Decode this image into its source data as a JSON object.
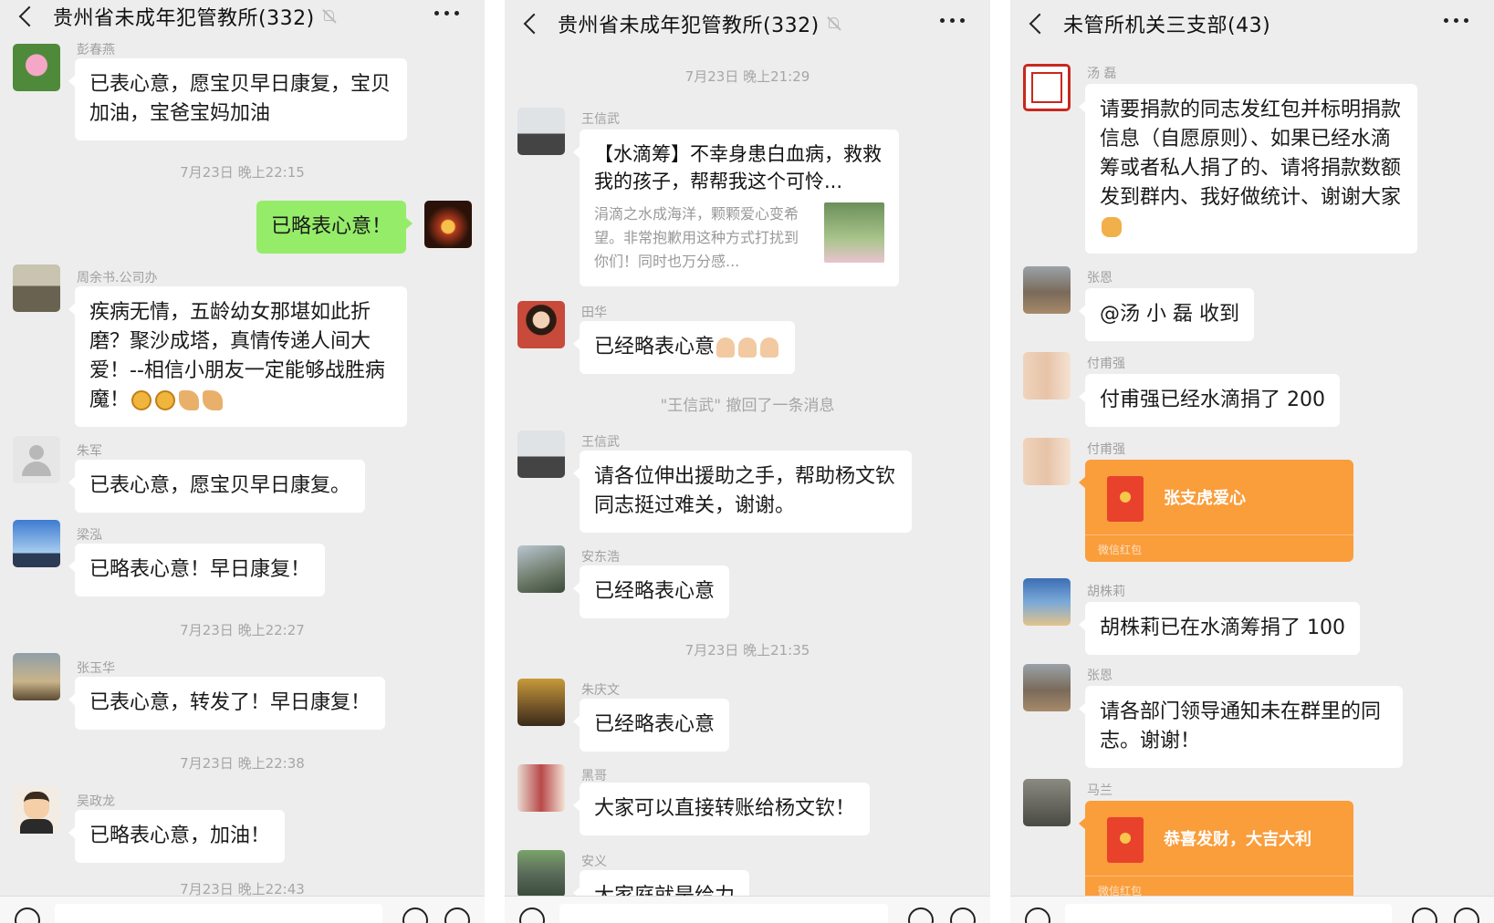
{
  "panels": [
    {
      "title": "贵州省未成年犯管教所(332)",
      "muted": true,
      "items": [
        {
          "kind": "msg",
          "name": "彭春燕",
          "lines": [
            "已表心意，愿宝贝早日康复，宝贝",
            "加油，宝爸宝妈加油"
          ],
          "avatar": "lotus"
        },
        {
          "kind": "time",
          "text": "7月23日 晚上22:15"
        },
        {
          "kind": "self",
          "text": "已略表心意！",
          "avatar": "fireworks"
        },
        {
          "kind": "msg",
          "name": "周余书.公司办",
          "lines": [
            "疾病无情，五龄幼女那堪如此折",
            "磨？聚沙成塔，真情传递人间大",
            "爱！--相信小朋友一定能够战胜病",
            "魔！"
          ],
          "emoji": [
            "fist",
            "fist",
            "arm",
            "arm"
          ],
          "avatar": "person-street"
        },
        {
          "kind": "msg",
          "name": "朱军",
          "lines": [
            "已表心意，愿宝贝早日康复。"
          ],
          "avatar": "default"
        },
        {
          "kind": "msg",
          "name": "梁泓",
          "lines": [
            "已略表心意！早日康复！"
          ],
          "avatar": "sky-person"
        },
        {
          "kind": "time",
          "text": "7月23日 晚上22:27"
        },
        {
          "kind": "msg",
          "name": "张玉华",
          "lines": [
            "已表心意，转发了！早日康复！"
          ],
          "avatar": "tree"
        },
        {
          "kind": "time",
          "text": "7月23日 晚上22:38"
        },
        {
          "kind": "msg",
          "name": "吴政龙",
          "lines": [
            "已略表心意，加油！"
          ],
          "avatar": "cartoon"
        },
        {
          "kind": "time",
          "text": "7月23日 晚上22:43"
        }
      ]
    },
    {
      "title": "贵州省未成年犯管教所(332)",
      "muted": true,
      "items": [
        {
          "kind": "time",
          "text": "7月23日 晚上21:29"
        },
        {
          "kind": "link",
          "name": "王信武",
          "title": "【水滴筹】不幸身患白血病，救救我的孩子，帮帮我这个可怜...",
          "desc": "涓滴之水成海洋，颗颗爱心变希望。非常抱歉用这种方式打扰到你们！同时也万分感...",
          "avatar": "man-building"
        },
        {
          "kind": "msg",
          "name": "田华",
          "lines": [
            "已经略表心意"
          ],
          "emoji": [
            "pray",
            "pray",
            "pray"
          ],
          "avatar": "doll"
        },
        {
          "kind": "sys",
          "text": "\"王信武\" 撤回了一条消息"
        },
        {
          "kind": "msg",
          "name": "王信武",
          "lines": [
            "请各位伸出援助之手，帮助杨文钦",
            "同志挺过难关，谢谢。"
          ],
          "avatar": "man-building"
        },
        {
          "kind": "msg",
          "name": "安东浩",
          "lines": [
            "已经略表心意"
          ],
          "avatar": "city"
        },
        {
          "kind": "time",
          "text": "7月23日 晚上21:35"
        },
        {
          "kind": "msg",
          "name": "朱庆文",
          "lines": [
            "已经略表心意"
          ],
          "avatar": "gate"
        },
        {
          "kind": "msg",
          "name": "黑哥",
          "lines": [
            "大家可以直接转账给杨文钦！"
          ],
          "avatar": "kids"
        },
        {
          "kind": "msg",
          "name": "安义",
          "lines": [
            "大家庭就是给力"
          ],
          "avatar": "road"
        }
      ]
    },
    {
      "title": "未管所机关三支部(43)",
      "muted": false,
      "items": [
        {
          "kind": "msg",
          "name": "汤 磊",
          "lines": [
            "请要捐款的同志发红包并标明捐款",
            "信息（自愿原则）、如果已经水滴",
            "筹或者私人捐了的、请将捐款数额",
            "发到群内、我好做统计、谢谢大家"
          ],
          "emoji": [
            "shake"
          ],
          "avatar": "seal"
        },
        {
          "kind": "msg",
          "name": "张恩",
          "lines": [
            "@汤 小 磊  收到"
          ],
          "avatar": "rocks"
        },
        {
          "kind": "msg",
          "name": "付甫强",
          "lines": [
            "付甫强已经水滴捐了 200"
          ],
          "avatar": "baby"
        },
        {
          "kind": "redpacket",
          "name": "付甫强",
          "text": "张支虎爱心",
          "foot": "微信红包",
          "avatar": "baby"
        },
        {
          "kind": "msg",
          "name": "胡株莉",
          "lines": [
            "胡株莉已在水滴筹捐了 100"
          ],
          "avatar": "cart"
        },
        {
          "kind": "msg",
          "name": "张恩",
          "lines": [
            "请各部门领导通知未在群里的同",
            "志。谢谢！"
          ],
          "avatar": "rocks"
        },
        {
          "kind": "redpacket",
          "name": "马兰",
          "text": "恭喜发财，大吉大利",
          "foot": "微信红包",
          "avatar": "cat"
        }
      ]
    }
  ],
  "colors": {
    "bg": "#ededed",
    "self_bubble": "#95ec69",
    "red_packet": "#fa9d3b"
  }
}
